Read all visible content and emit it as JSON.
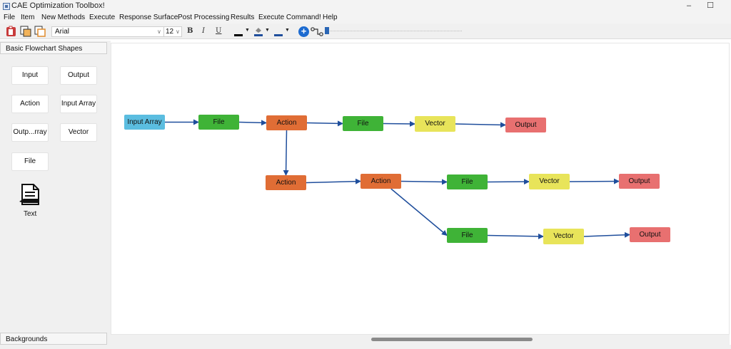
{
  "window": {
    "title": "CAE Optimization Toolbox!",
    "controls": {
      "minimize": "–",
      "maximize": "☐"
    }
  },
  "menu": [
    "File",
    "Item",
    "New Methods",
    "Execute",
    "Response Surface",
    "Post Processing",
    "Results",
    "Execute Command!",
    "Help"
  ],
  "toolbar": {
    "font_family": "Arial",
    "font_size": "12",
    "bold": "B",
    "italic": "I",
    "underline": "U",
    "zoom_in": "+",
    "colors": {
      "text": "#000000",
      "fill": "#1f4e9c",
      "line": "#1f4e9c",
      "red_icon": "#c83c3c",
      "orange_icon": "#e08a2a"
    }
  },
  "panel": {
    "header": "Basic Flowchart Shapes",
    "shapes": [
      "Input",
      "Output",
      "Action",
      "Input Array",
      "Outp...rray",
      "Vector",
      "File"
    ],
    "text_tool": "Text",
    "footer": "Backgrounds"
  },
  "flowchart": {
    "colors": {
      "input_array": "#5bbde0",
      "file": "#3fb337",
      "action": "#e06d35",
      "vector": "#e8e45a",
      "output": "#e87070",
      "edge": "#1f4e9c"
    },
    "nodes": [
      {
        "id": "input-array-1",
        "label": "Input Array",
        "kind": "input_array"
      },
      {
        "id": "file-1",
        "label": "File",
        "kind": "file"
      },
      {
        "id": "action-1",
        "label": "Action",
        "kind": "action"
      },
      {
        "id": "file-2",
        "label": "File",
        "kind": "file"
      },
      {
        "id": "vector-1",
        "label": "Vector",
        "kind": "vector"
      },
      {
        "id": "output-1",
        "label": "Output",
        "kind": "output"
      },
      {
        "id": "action-2",
        "label": "Action",
        "kind": "action"
      },
      {
        "id": "action-3",
        "label": "Action",
        "kind": "action"
      },
      {
        "id": "file-3",
        "label": "File",
        "kind": "file"
      },
      {
        "id": "vector-2",
        "label": "Vector",
        "kind": "vector"
      },
      {
        "id": "output-2",
        "label": "Output",
        "kind": "output"
      },
      {
        "id": "file-4",
        "label": "File",
        "kind": "file"
      },
      {
        "id": "vector-3",
        "label": "Vector",
        "kind": "vector"
      },
      {
        "id": "output-3",
        "label": "Output",
        "kind": "output"
      }
    ],
    "edges": [
      [
        "input-array-1",
        "file-1"
      ],
      [
        "file-1",
        "action-1"
      ],
      [
        "action-1",
        "file-2"
      ],
      [
        "file-2",
        "vector-1"
      ],
      [
        "vector-1",
        "output-1"
      ],
      [
        "action-1",
        "action-2"
      ],
      [
        "action-2",
        "action-3"
      ],
      [
        "action-3",
        "file-3"
      ],
      [
        "file-3",
        "vector-2"
      ],
      [
        "vector-2",
        "output-2"
      ],
      [
        "action-3",
        "file-4"
      ],
      [
        "file-4",
        "vector-3"
      ],
      [
        "vector-3",
        "output-3"
      ]
    ]
  }
}
